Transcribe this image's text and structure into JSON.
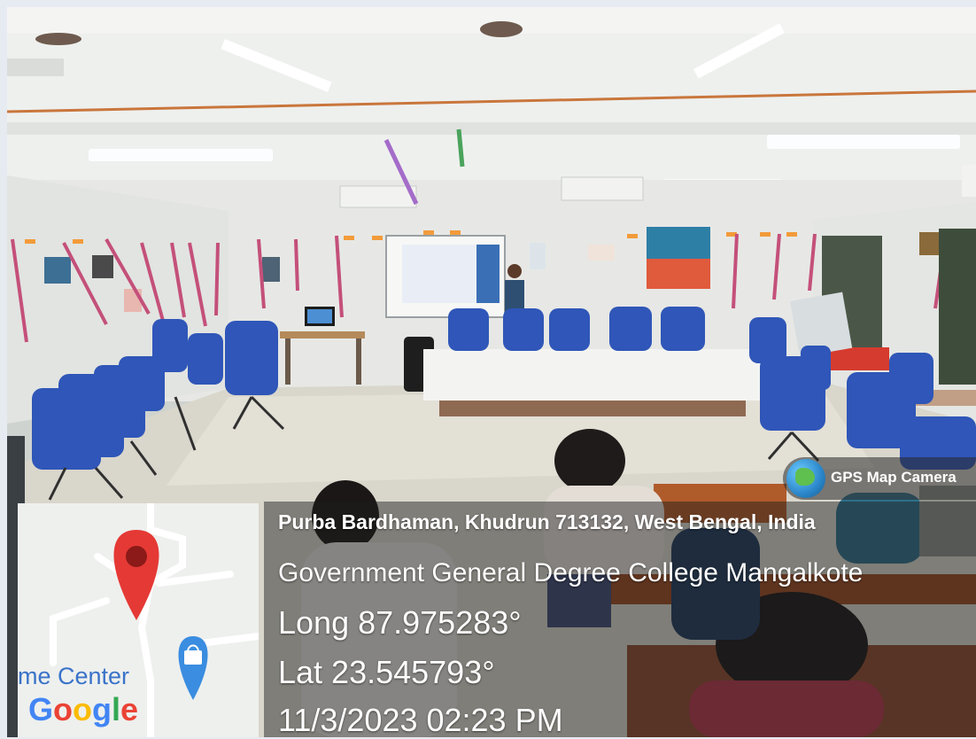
{
  "badge": {
    "label": "GPS Map Camera",
    "icon": "globe-icon"
  },
  "location": {
    "address": "Purba Bardhaman, Khudrun 713132, West Bengal, India",
    "place": "Government General Degree College Mangalkote",
    "longitude": "Long 87.975283°",
    "latitude": "Lat 23.545793°",
    "datetime": "11/3/2023 02:23 PM"
  },
  "map": {
    "place_label": "me Center",
    "provider": "Google",
    "pin_icon": "map-pin-icon",
    "shopping_icon": "shopping-bag-icon",
    "pin_color": "#e53935",
    "accent_blue": "#3a73c9"
  }
}
